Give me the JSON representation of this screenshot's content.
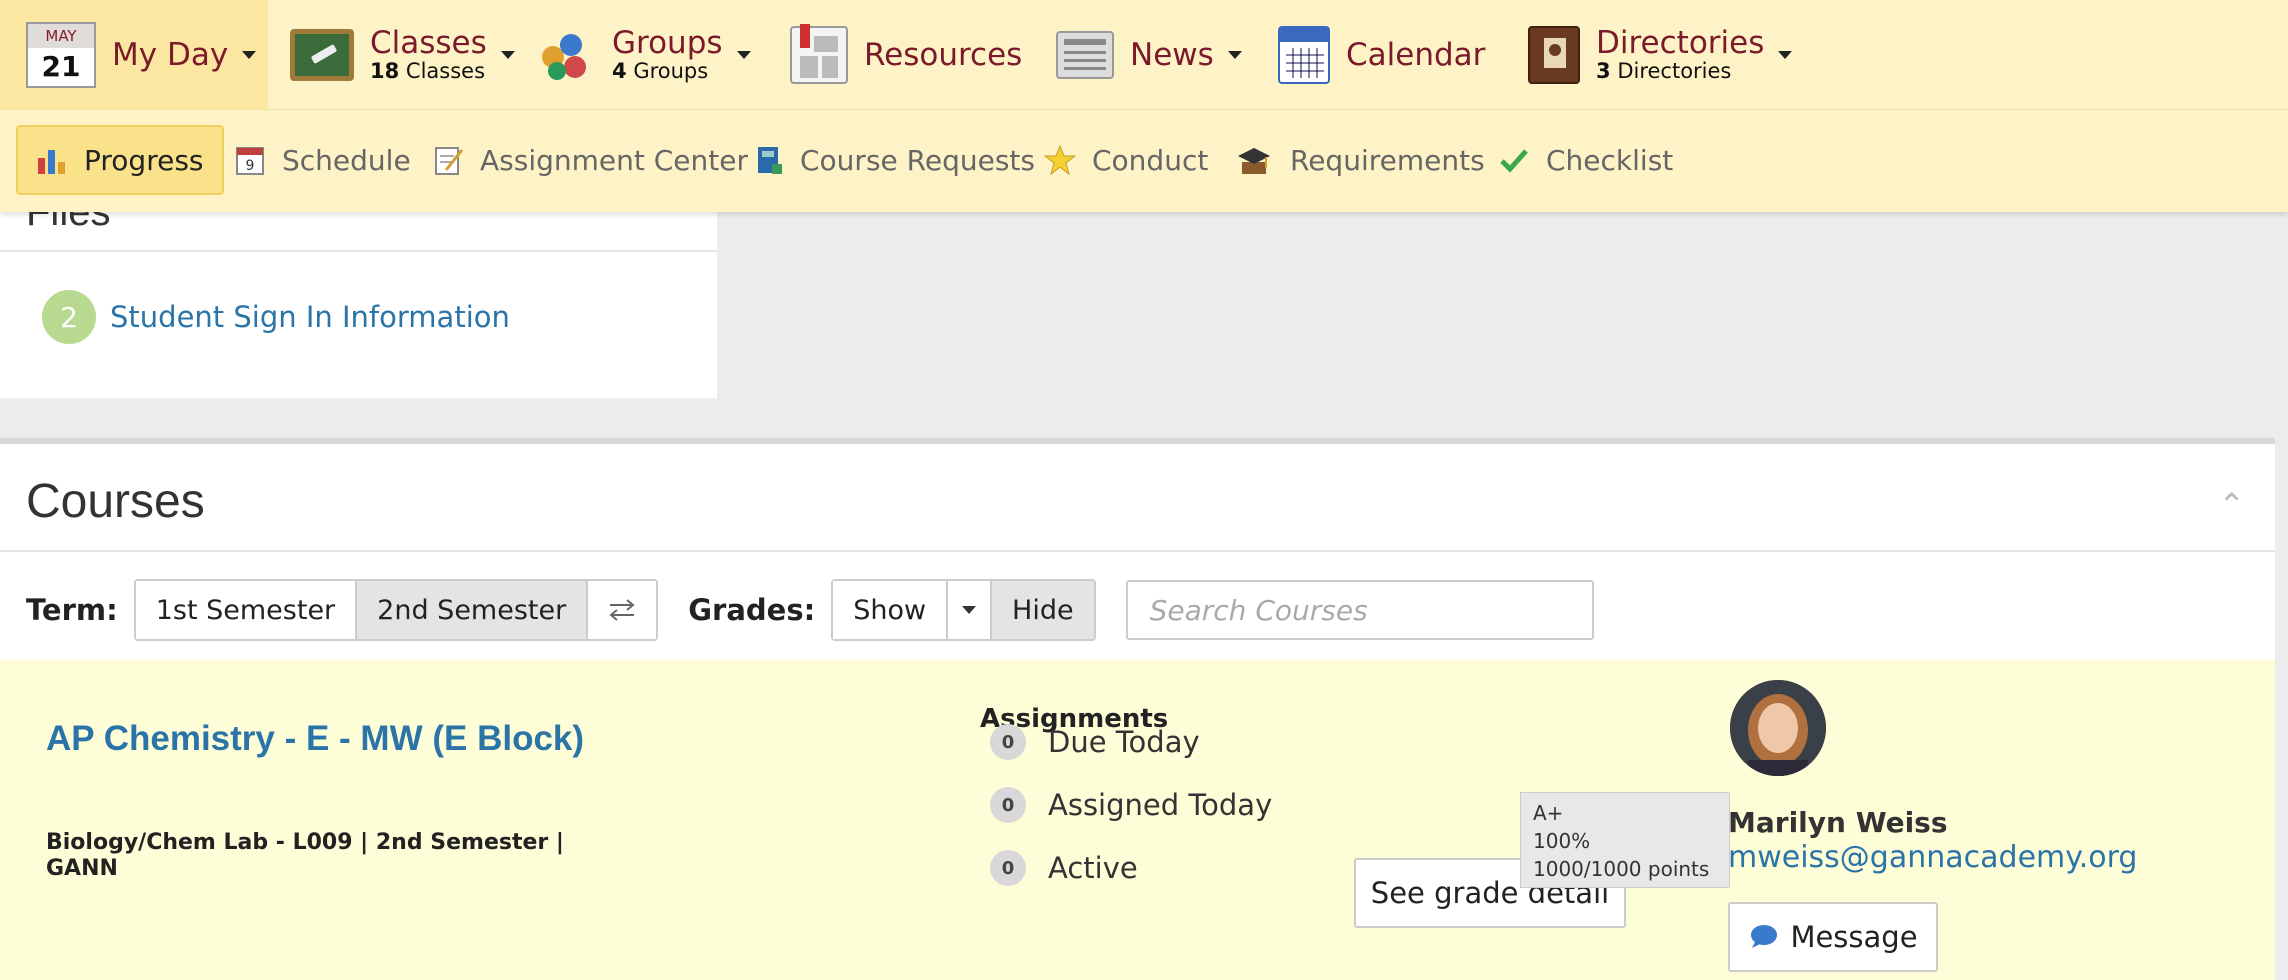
{
  "topnav": {
    "myday": {
      "month": "MAY",
      "day": "21",
      "label": "My Day"
    },
    "classes": {
      "label": "Classes",
      "count": "18",
      "unit": "Classes"
    },
    "groups": {
      "label": "Groups",
      "count": "4",
      "unit": "Groups"
    },
    "resources": {
      "label": "Resources"
    },
    "news": {
      "label": "News"
    },
    "calendar": {
      "label": "Calendar"
    },
    "directories": {
      "label": "Directories",
      "count": "3",
      "unit": "Directories"
    }
  },
  "subnav": {
    "items": [
      {
        "label": "Progress",
        "icon": "bar-chart-icon",
        "active": true
      },
      {
        "label": "Schedule",
        "icon": "calendar-9-icon"
      },
      {
        "label": "Assignment Center",
        "icon": "notepad-icon"
      },
      {
        "label": "Course Requests",
        "icon": "book-icon"
      },
      {
        "label": "Conduct",
        "icon": "star-icon"
      },
      {
        "label": "Requirements",
        "icon": "graduation-cap-icon"
      },
      {
        "label": "Checklist",
        "icon": "checkmark-icon"
      }
    ]
  },
  "files": {
    "title": "Files",
    "items": [
      {
        "number": "2",
        "label": "Student Sign In Information"
      }
    ]
  },
  "courses": {
    "title": "Courses",
    "term_label": "Term:",
    "terms": [
      "1st Semester",
      "2nd Semester"
    ],
    "selected_term": "2nd Semester",
    "grades_label": "Grades:",
    "grades_show": "Show",
    "grades_hide": "Hide",
    "search_placeholder": "Search Courses",
    "card": {
      "title": "AP Chemistry - E - MW (E Block)",
      "meta": "Biology/Chem Lab - L009 | 2nd Semester | GANN",
      "assignments_heading": "Assignments",
      "assignments": [
        {
          "count": "0",
          "label": "Due Today"
        },
        {
          "count": "0",
          "label": "Assigned Today"
        },
        {
          "count": "0",
          "label": "Active"
        }
      ],
      "grade_button": "See grade detail",
      "tooltip": {
        "letter": "A+",
        "percent": "100%",
        "points": "1000/1000 points"
      },
      "teacher": {
        "name": "Marilyn Weiss",
        "email": "mweiss@gannacademy.org"
      },
      "message_button": "Message"
    }
  },
  "colors": {
    "nav_bg": "#fdf3c6",
    "nav_text": "#7a1a2a",
    "link": "#2b74a8",
    "card_bg": "#fdfdd8"
  }
}
